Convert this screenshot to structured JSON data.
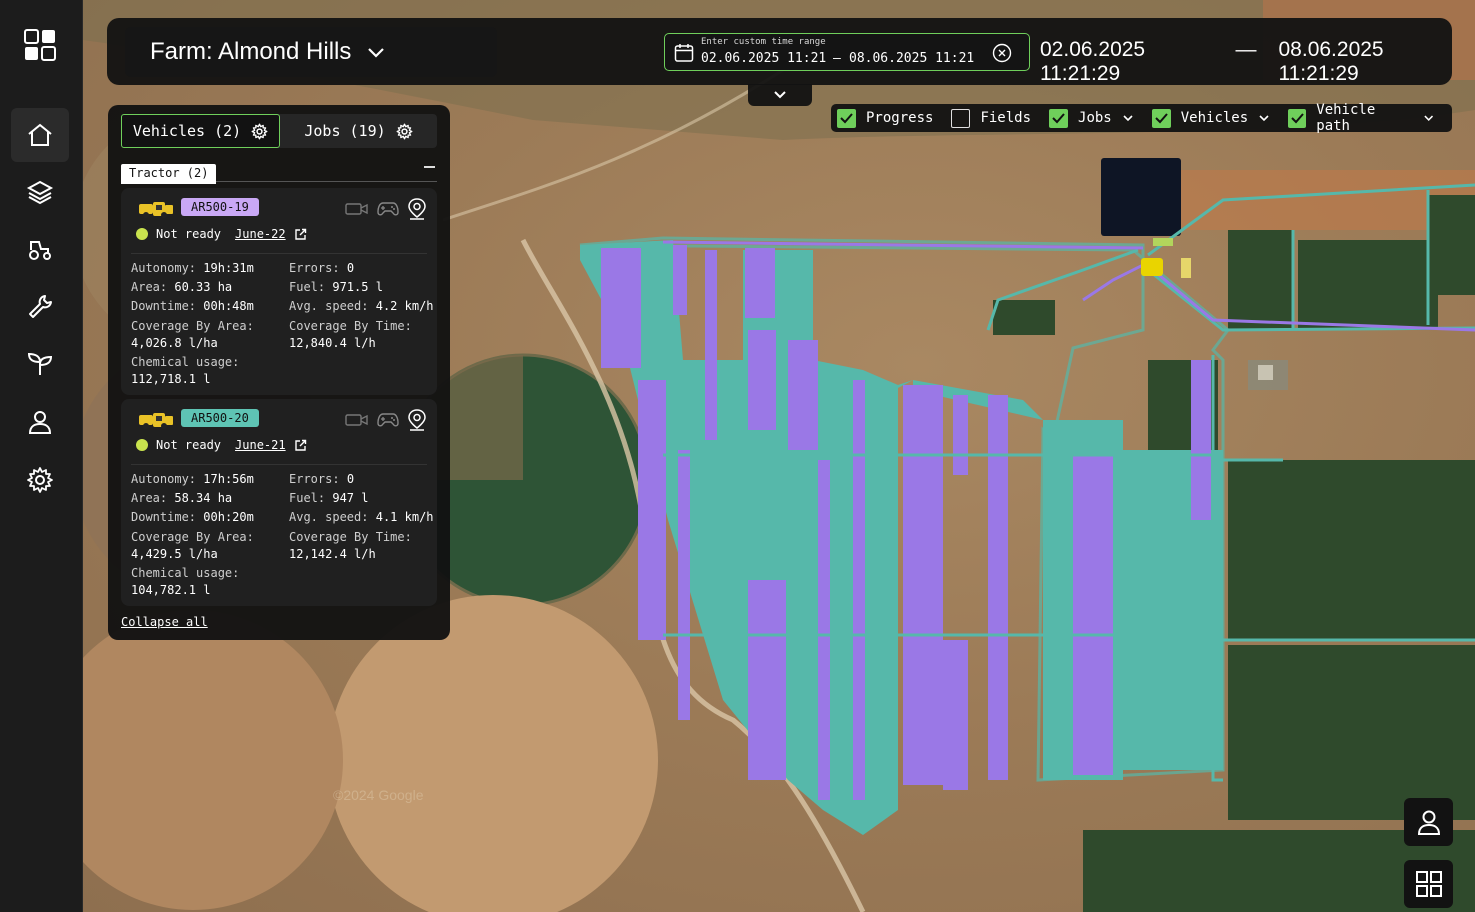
{
  "header": {
    "farm_label": "Farm: Almond Hills",
    "range_hint": "Enter custom time range",
    "range_from": "02.06.2025 11:21",
    "range_to": "08.06.2025 11:21",
    "display_from": "02.06.2025 11:21:29",
    "display_sep": "—",
    "display_to": "08.06.2025 11:21:29"
  },
  "layers": [
    {
      "label": "Progress",
      "checked": true,
      "dropdown": false
    },
    {
      "label": "Fields",
      "checked": false,
      "dropdown": false
    },
    {
      "label": "Jobs",
      "checked": true,
      "dropdown": true
    },
    {
      "label": "Vehicles",
      "checked": true,
      "dropdown": true
    },
    {
      "label": "Vehicle path",
      "checked": true,
      "dropdown": true
    }
  ],
  "panel": {
    "tabs": {
      "vehicles": "Vehicles (2)",
      "jobs": "Jobs (19)"
    },
    "group_label": "Tractor (2)",
    "collapse_all": "Collapse all",
    "vehicles": [
      {
        "id": "AR500-19",
        "id_color": "#c9a8f5",
        "status": "Not ready",
        "job": "June-22",
        "autonomy_k": "Autonomy:",
        "autonomy": "19h:31m",
        "errors_k": "Errors:",
        "errors": "0",
        "area_k": "Area:",
        "area": "60.33 ha",
        "fuel_k": "Fuel:",
        "fuel": "971.5 l",
        "downtime_k": "Downtime:",
        "downtime": "00h:48m",
        "speed_k": "Avg. speed:",
        "speed": "4.2 km/h",
        "cov_area_k": "Coverage By Area:",
        "cov_area": "4,026.8 l/ha",
        "cov_time_k": "Coverage By Time:",
        "cov_time": "12,840.4 l/h",
        "chem_k": "Chemical usage:",
        "chem": "112,718.1 l"
      },
      {
        "id": "AR500-20",
        "id_color": "#5ec4b4",
        "status": "Not ready",
        "job": "June-21",
        "autonomy_k": "Autonomy:",
        "autonomy": "17h:56m",
        "errors_k": "Errors:",
        "errors": "0",
        "area_k": "Area:",
        "area": "58.34 ha",
        "fuel_k": "Fuel:",
        "fuel": "947 l",
        "downtime_k": "Downtime:",
        "downtime": "00h:20m",
        "speed_k": "Avg. speed:",
        "speed": "4.1 km/h",
        "cov_area_k": "Coverage By Area:",
        "cov_area": "4,429.5 l/ha",
        "cov_time_k": "Coverage By Time:",
        "cov_time": "12,142.4 l/h",
        "chem_k": "Chemical usage:",
        "chem": "104,782.1 l"
      }
    ]
  },
  "map": {
    "watermark": "©2024 Google",
    "path_colors": {
      "teal": "#56b8aa",
      "purple": "#9a78e6"
    }
  }
}
